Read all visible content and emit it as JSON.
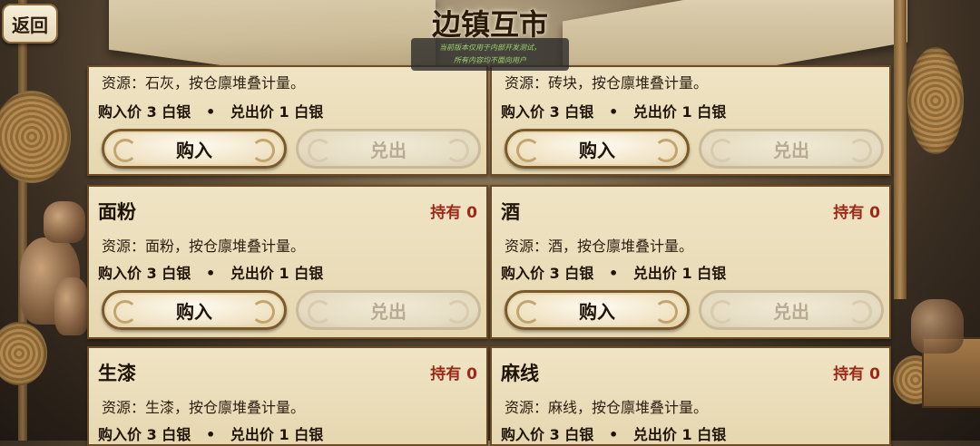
{
  "header": {
    "back_label": "返回",
    "title": "边镇互市",
    "notice_line1": "当前版本仅用于内部开发测试，",
    "notice_line2": "所有内容均不面向用户"
  },
  "items": [
    {
      "name": "",
      "holding": "",
      "source": "资源：石灰，按仓廪堆叠计量。",
      "prices": "购入价 3 白银   •   兑出价 1 白银",
      "buy": "购入",
      "sell": "兑出"
    },
    {
      "name": "",
      "holding": "",
      "source": "资源：砖块，按仓廪堆叠计量。",
      "prices": "购入价 3 白银   •   兑出价 1 白银",
      "buy": "购入",
      "sell": "兑出"
    },
    {
      "name": "面粉",
      "holding": "持有 0",
      "source": "资源：面粉，按仓廪堆叠计量。",
      "prices": "购入价 3 白银   •   兑出价 1 白银",
      "buy": "购入",
      "sell": "兑出"
    },
    {
      "name": "酒",
      "holding": "持有 0",
      "source": "资源：酒，按仓廪堆叠计量。",
      "prices": "购入价 3 白银   •   兑出价 1 白银",
      "buy": "购入",
      "sell": "兑出"
    },
    {
      "name": "生漆",
      "holding": "持有 0",
      "source": "资源：生漆，按仓廪堆叠计量。",
      "prices": "购入价 3 白银   •   兑出价 1 白银",
      "buy": "",
      "sell": ""
    },
    {
      "name": "麻线",
      "holding": "持有 0",
      "source": "资源：麻线，按仓廪堆叠计量。",
      "prices": "购入价 3 白银   •   兑出价 1 白银",
      "buy": "",
      "sell": ""
    }
  ]
}
